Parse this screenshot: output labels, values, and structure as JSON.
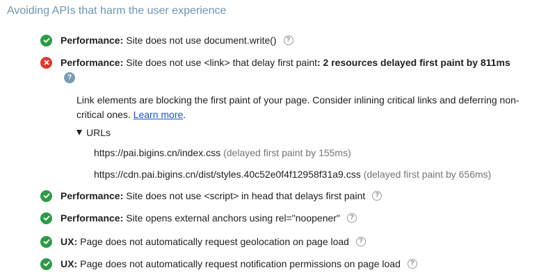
{
  "section": {
    "title": "Avoiding APIs that harm the user experience"
  },
  "audits": [
    {
      "status": "pass",
      "category": "Performance:",
      "text": "Site does not use document.write()",
      "summary": ""
    },
    {
      "status": "fail",
      "category": "Performance:",
      "text": "Site does not use <link> that delay first paint",
      "summary": ": 2 resources delayed first paint by 811ms",
      "details": {
        "description": "Link elements are blocking the first paint of your page. Consider inlining critical links and deferring non-critical ones. ",
        "learn_more": "Learn more",
        "period": ".",
        "urls_label": "URLs",
        "urls": [
          {
            "url": "https://pai.bigins.cn/index.css",
            "note": "(delayed first paint by 155ms)"
          },
          {
            "url": "https://cdn.pai.bigins.cn/dist/styles.40c52e0f4f12958f31a9.css",
            "note": "(delayed first paint by 656ms)"
          }
        ]
      }
    },
    {
      "status": "pass",
      "category": "Performance:",
      "text": "Site does not use <script> in head that delays first paint",
      "summary": ""
    },
    {
      "status": "pass",
      "category": "Performance:",
      "text": "Site opens external anchors using rel=\"noopener\"",
      "summary": ""
    },
    {
      "status": "pass",
      "category": "UX:",
      "text": "Page does not automatically request geolocation on page load",
      "summary": ""
    },
    {
      "status": "pass",
      "category": "UX:",
      "text": "Page does not automatically request notification permissions on page load",
      "summary": ""
    }
  ],
  "help_glyph": "?",
  "colors": {
    "title": "#6f95b0",
    "pass": "#2e9a48",
    "fail": "#e0382f",
    "link": "#1a57c9",
    "muted": "#757575"
  },
  "icons": {
    "pass": "check-circle-icon",
    "fail": "x-circle-icon",
    "help": "question-mark-icon",
    "toggle": "triangle-down-icon"
  }
}
